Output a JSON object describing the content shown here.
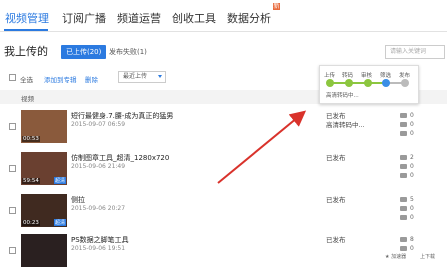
{
  "nav": {
    "tabs": [
      {
        "label": "视频管理"
      },
      {
        "label": "订阅广播"
      },
      {
        "label": "频道运营"
      },
      {
        "label": "创收工具"
      },
      {
        "label": "数据分析"
      }
    ],
    "badge": "新"
  },
  "page": {
    "title": "我上传的",
    "uploaded_button": "已上传(20)",
    "failed_link": "发布失败(1)",
    "search_placeholder": "请输入关键词"
  },
  "toolbar": {
    "select_all": "全选",
    "add_to_album": "添加到专辑",
    "delete": "删除",
    "sort_selected": "最近上传"
  },
  "table": {
    "header": "视频",
    "rows": [
      {
        "title": "短行最健身.7.腰-成为真正的猛男",
        "date": "2015-09-07 06:59",
        "duration": "00:53",
        "status": "已发布",
        "status2": "高清转码中...",
        "stats": [
          "0",
          "0",
          "0"
        ],
        "thumb_color": "#8a5a3c"
      },
      {
        "title": "仿制图章工具_超清_1280x720",
        "date": "2015-09-06 21:49",
        "duration": "59:54",
        "hd": "超清",
        "status": "已发布",
        "status2": "",
        "stats": [
          "2",
          "0",
          "0"
        ],
        "thumb_color": "#6a4030"
      },
      {
        "title": "侧拉",
        "date": "2015-09-06 20:27",
        "duration": "00:23",
        "hd": "超清",
        "status": "已发布",
        "status2": "",
        "stats": [
          "5",
          "0",
          "0"
        ],
        "thumb_color": "#402a20"
      },
      {
        "title": "PS数据之脚笔工具",
        "date": "2015-09-06 19:51",
        "duration": "",
        "status": "已发布",
        "status2": "",
        "stats": [
          "8",
          "0"
        ],
        "thumb_color": "#2a2020"
      }
    ]
  },
  "popup": {
    "steps": [
      "上传",
      "转码",
      "审核",
      "筛选",
      "发布"
    ],
    "text": "高清转码中..."
  },
  "footer": {
    "left": "★ 加速器",
    "right": "上下载"
  },
  "colors": {
    "accent": "#2b7ae0",
    "step_done": "#8cc63f",
    "step_current": "#3a8ee6",
    "step_todo": "#bbbbbb",
    "arrow": "#d9322b"
  }
}
